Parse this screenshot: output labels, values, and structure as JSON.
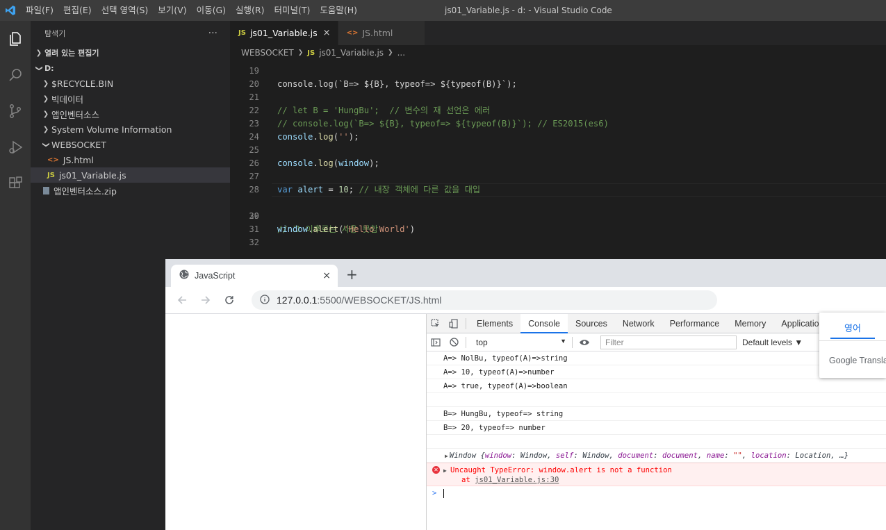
{
  "vscode": {
    "menu": [
      "파일(F)",
      "편집(E)",
      "선택 영역(S)",
      "보기(V)",
      "이동(G)",
      "실행(R)",
      "터미널(T)",
      "도움말(H)"
    ],
    "window_title": "js01_Variable.js - d: - Visual Studio Code",
    "sidebar": {
      "title": "탐색기",
      "more": "···",
      "open_editors": "열려 있는 편집기",
      "drive": "D:",
      "tree": [
        {
          "label": "$RECYCLE.BIN"
        },
        {
          "label": "빅데이터"
        },
        {
          "label": "앱인벤터소스"
        },
        {
          "label": "System Volume Information"
        },
        {
          "label": "WEBSOCKET"
        },
        {
          "label": "JS.html"
        },
        {
          "label": "js01_Variable.js"
        },
        {
          "label": "앱인벤터소스.zip"
        }
      ],
      "badge_js": "JS",
      "badge_html": "<>"
    },
    "tabs": [
      {
        "label": "js01_Variable.js",
        "close": "×"
      },
      {
        "label": "JS.html"
      }
    ],
    "breadcrumb": [
      "WEBSOCKET",
      "js01_Variable.js",
      "..."
    ],
    "code": {
      "line_numbers": [
        "19",
        "20",
        "21",
        "22",
        "23",
        "24",
        "25",
        "26",
        "27",
        "28",
        "29",
        "30",
        "31",
        "32"
      ],
      "l19": "console.log(`B=> ${B}, typeof=> ${typeof(B)}`);",
      "l21": "// let B = 'HungBu';  // 변수의 재 선언은 에러",
      "l22": "// console.log(`B=> ${B}, typeof=> ${typeof(B)}`); // ES2015(es6)",
      "l23a": "console",
      "l23b": ".",
      "l23c": "log",
      "l23d": "(",
      "l23e": "''",
      "l23f": ");",
      "l25a": "console",
      "l25b": ".",
      "l25c": "log",
      "l25d": "(",
      "l25e": "window",
      "l25f": ");",
      "l27a": "var",
      "l27b": " ",
      "l27c": "alert",
      "l27d": " = ",
      "l27e": "10",
      "l27f": "; ",
      "l27g": "// 내장 객체에 다른 값을 대입",
      "l29": "// 그 이후로는 사용 못함",
      "l30a": "window",
      "l30b": ".",
      "l30c": "alert",
      "l30d": "(",
      "l30e": "'Hello World'",
      "l30f": ")"
    }
  },
  "browser": {
    "tab_title": "JavaScript",
    "tab_close": "×",
    "new_tab": "+",
    "url_host": "127.0.0.1",
    "url_path": ":5500/WEBSOCKET/JS.html",
    "devtools": {
      "tabs": [
        "Elements",
        "Console",
        "Sources",
        "Network",
        "Performance",
        "Memory",
        "Applicatio"
      ],
      "context": "top",
      "context_arrow": "▼",
      "filter_placeholder": "Filter",
      "levels": "Default levels ▼",
      "logs": [
        "A=> NolBu, typeof(A)=>string",
        "A=> 10, typeof(A)=>number",
        "A=> true, typeof(A)=>boolean",
        "",
        "B=> HungBu, typeof=> string",
        "B=> 20, typeof=> number",
        ""
      ],
      "window_obj": {
        "arrow": "▶",
        "prefix": "Window {",
        "k1": "window",
        "v1": ": Window, ",
        "k2": "self",
        "v2": ": Window, ",
        "k3": "document",
        "v3sep": ": ",
        "v3": "document",
        "v3end": ", ",
        "k4": "name",
        "v4sep": ": ",
        "v4": "\"\"",
        "v4end": ", ",
        "k5": "location",
        "v5": ": Location, …}"
      },
      "error": {
        "message": "Uncaught TypeError: window.alert is not a function",
        "at": "at ",
        "link": "js01_Variable.js:30"
      },
      "prompt": ">"
    }
  },
  "translate_popup": {
    "tab": "영어",
    "brand": "Google Translat"
  },
  "colors": {
    "accent_blue": "#1a73e8",
    "vscode_bg": "#1e1e1e",
    "error_red": "#fe0000"
  }
}
